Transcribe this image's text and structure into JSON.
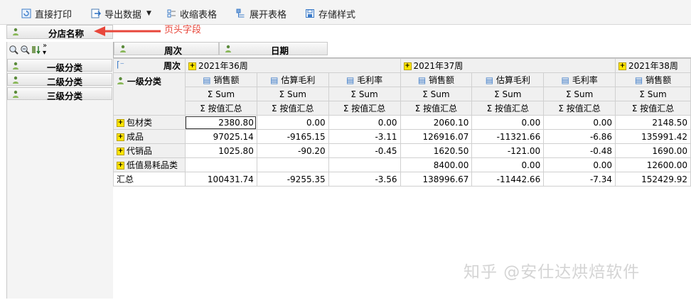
{
  "toolbar": {
    "print_label": "直接打印",
    "export_label": "导出数据",
    "collapse_label": "收缩表格",
    "expand_label": "展开表格",
    "save_style_label": "存储样式"
  },
  "page_field": {
    "label": "分店名称"
  },
  "annotation": {
    "text": "页头字段",
    "color": "#e8473b"
  },
  "row_fields": [
    "一级分类",
    "二级分类",
    "三级分类"
  ],
  "col_fields": {
    "week_label": "周次",
    "date_label": "日期"
  },
  "grid": {
    "corner_week": "周次",
    "corner_rowfield": "一级分类",
    "weeks": [
      "2021年36周",
      "2021年37周",
      "2021年38周"
    ],
    "measures": [
      "销售额",
      "估算毛利",
      "毛利率",
      "销售额",
      "估算毛利",
      "毛利率",
      "销售额"
    ],
    "sum_label": "Σ Sum",
    "agg_label": "Σ 按值汇总",
    "rows": [
      {
        "label": "包材类",
        "values": [
          "2380.80",
          "0.00",
          "0.00",
          "2060.10",
          "0.00",
          "0.00",
          "2148.50"
        ]
      },
      {
        "label": "成品",
        "values": [
          "97025.14",
          "-9165.15",
          "-3.11",
          "126916.07",
          "-11321.66",
          "-6.86",
          "135991.42"
        ]
      },
      {
        "label": "代销品",
        "values": [
          "1025.80",
          "-90.20",
          "-0.45",
          "1620.50",
          "-121.00",
          "-0.48",
          "1690.00"
        ]
      },
      {
        "label": "低值易耗品类",
        "values": [
          "",
          "",
          "",
          "8400.00",
          "0.00",
          "0.00",
          "12600.00"
        ]
      }
    ],
    "total": {
      "label": "汇总",
      "values": [
        "100431.74",
        "-9255.35",
        "-3.56",
        "138996.67",
        "-11442.66",
        "-7.34",
        "152429.92"
      ]
    }
  },
  "watermark": "知乎 @安仕达烘焙软件",
  "colors": {
    "accent_yellow": "#ffe600",
    "header_bg": "#f0f0f0",
    "annotation_red": "#e8473b"
  }
}
